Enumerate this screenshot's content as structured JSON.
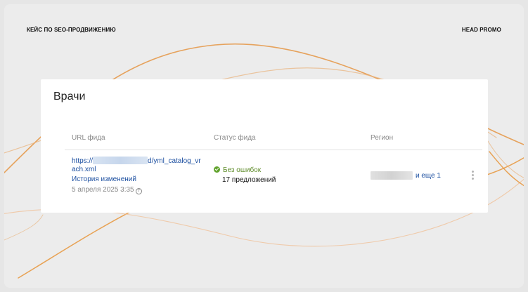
{
  "header": {
    "left_title": "КЕЙС ПО SEO-ПРОДВИЖЕНИЮ",
    "right_title": "HEAD PROMO"
  },
  "card": {
    "title": "Врачи",
    "columns": {
      "url": "URL фида",
      "status": "Статус фида",
      "region": "Регион"
    },
    "feed": {
      "url_prefix": "https://",
      "url_suffix": "d/yml_catalog_vr",
      "url_line2": "ach.xml",
      "history_link": "История изменений",
      "date": "5 апреля 2025 3:35",
      "status_text": "Без ошибок",
      "offers_text": "17 предложений",
      "region_more": "и еще 1"
    }
  },
  "colors": {
    "link": "#1c4fa0",
    "status_ok": "#62a32e",
    "accent_lines": "#e8953a"
  }
}
